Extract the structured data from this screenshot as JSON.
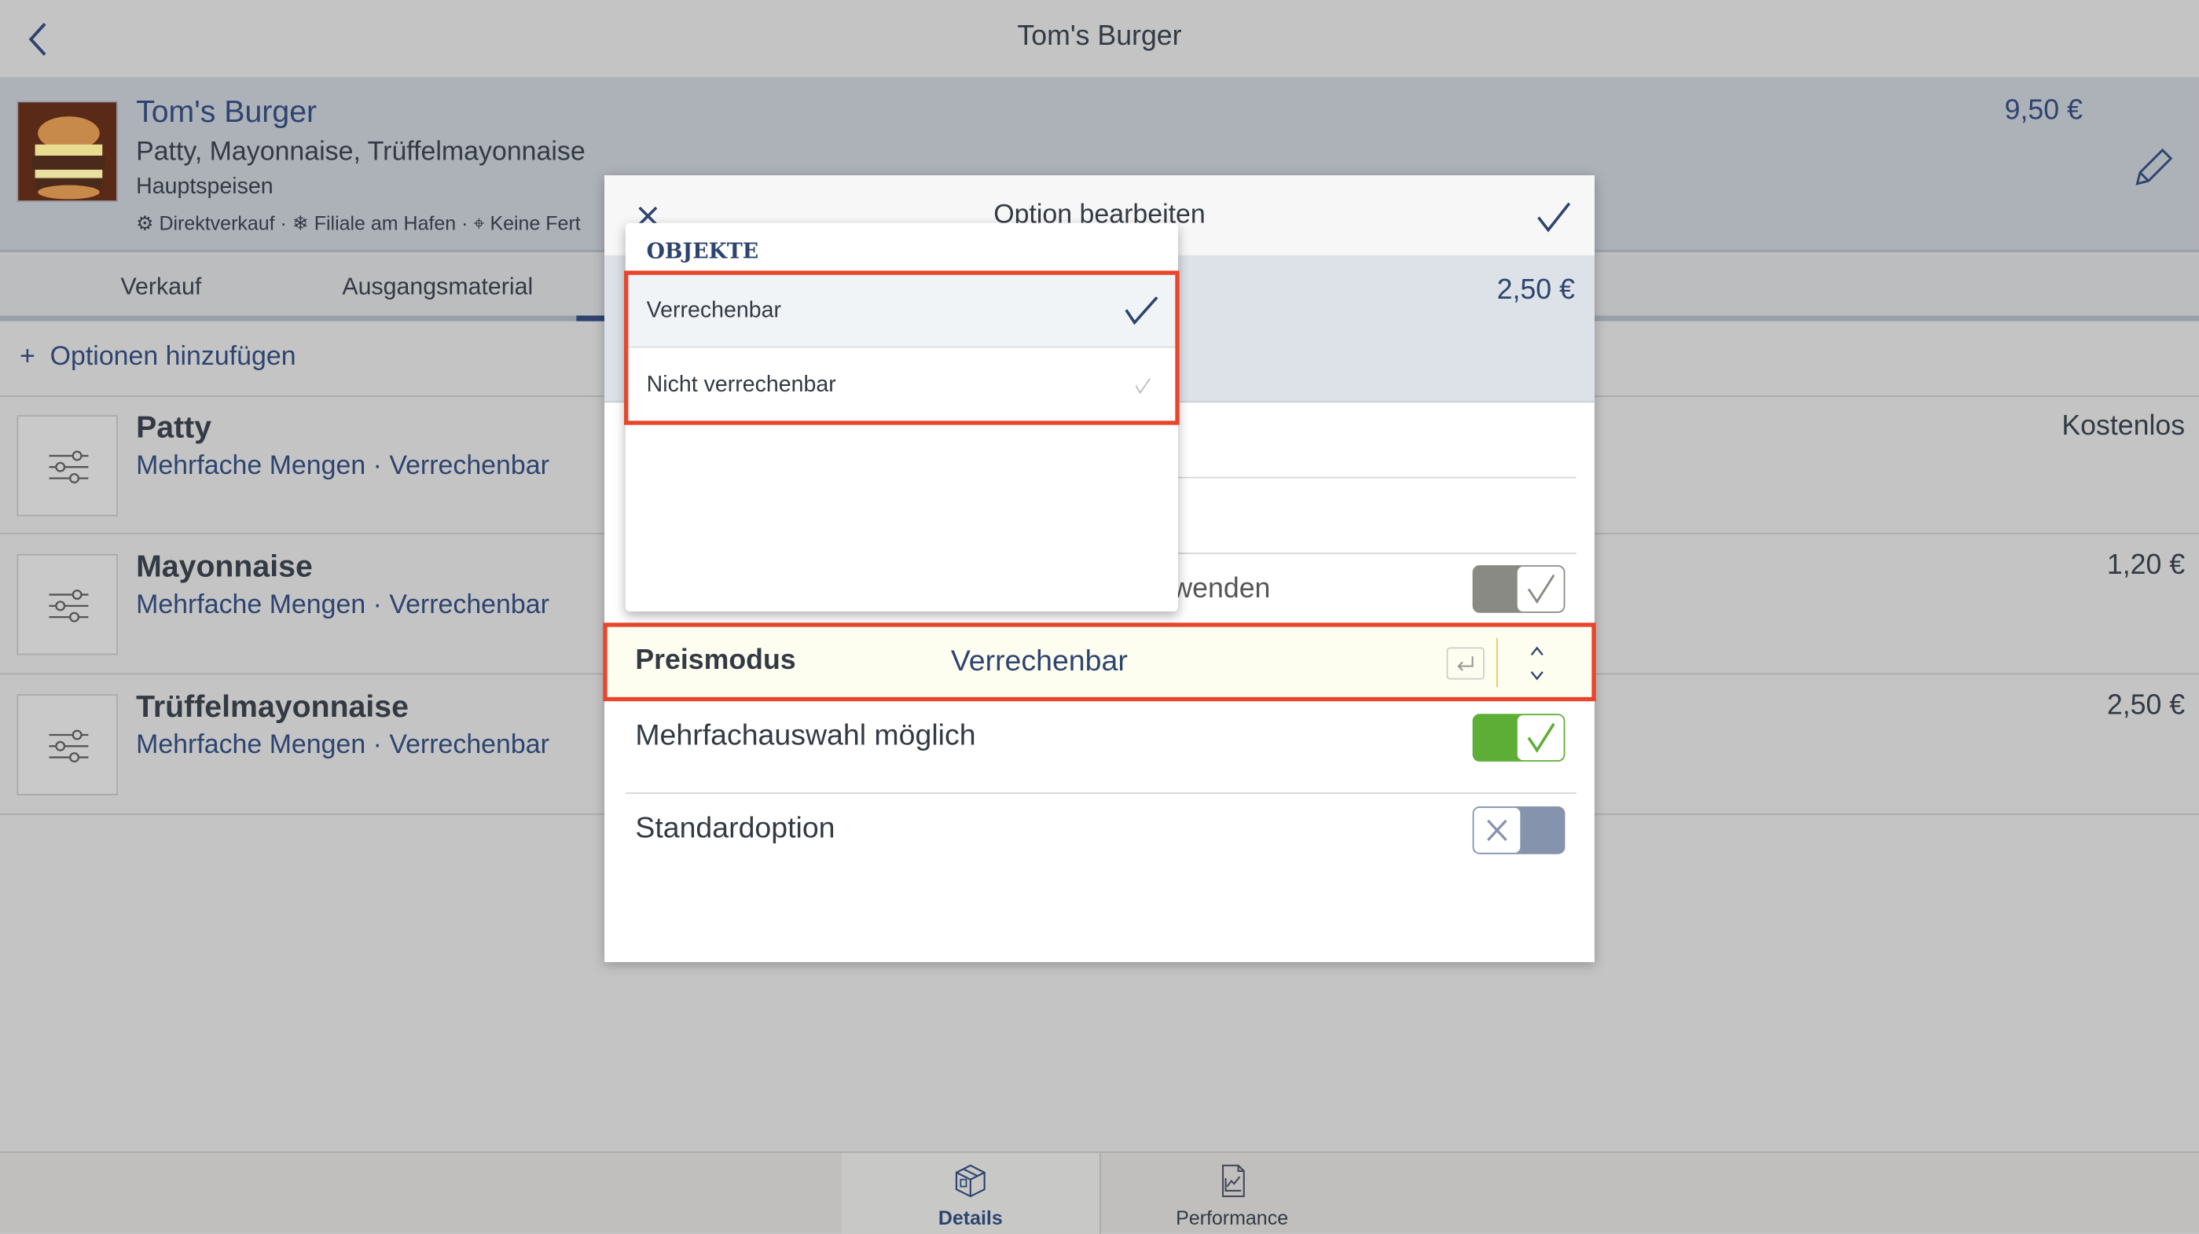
{
  "topbar": {
    "title": "Tom's Burger",
    "back_icon": "chevron-left-icon"
  },
  "product": {
    "name": "Tom's Burger",
    "ingredients": "Patty, Mayonnaise, Trüffelmayonnaise",
    "category": "Hauptspeisen",
    "tags": [
      "Direktverkauf",
      "Filiale am Hafen",
      "Keine Fert"
    ],
    "price": "9,50 €"
  },
  "tabs": [
    {
      "label": "Verkauf"
    },
    {
      "label": "Ausgangsmaterial"
    }
  ],
  "add_options": "Optionen hinzufügen",
  "options": [
    {
      "name": "Patty",
      "sub": "Mehrfache Mengen · Verrechenbar",
      "price": "Kostenlos"
    },
    {
      "name": "Mayonnaise",
      "sub": "Mehrfache Mengen · Verrechenbar",
      "price": "1,20 €"
    },
    {
      "name": "Trüffelmayonnaise",
      "sub": "Mehrfache Mengen · Verrechenbar",
      "price": "2,50 €"
    }
  ],
  "modal": {
    "title": "Option bearbeiten",
    "price": "2,50 €",
    "row_partial": "verwenden",
    "price_mode_label": "Preismodus",
    "price_mode_value": "Verrechenbar",
    "multi_label": "Mehrfachauswahl möglich",
    "multi_on": true,
    "default_label": "Standardoption",
    "default_on": false,
    "partial_on": true
  },
  "dropdown": {
    "header": "OBJEKTE",
    "items": [
      {
        "label": "Verrechenbar",
        "selected": true
      },
      {
        "label": "Nicht verrechenbar",
        "selected": false
      }
    ]
  },
  "bottom_nav": [
    {
      "label": "Details",
      "active": true
    },
    {
      "label": "Performance",
      "active": false
    }
  ],
  "colors": {
    "accent": "#2d4470",
    "toggle_on": "#5dae36",
    "highlight": "#e8452c"
  }
}
